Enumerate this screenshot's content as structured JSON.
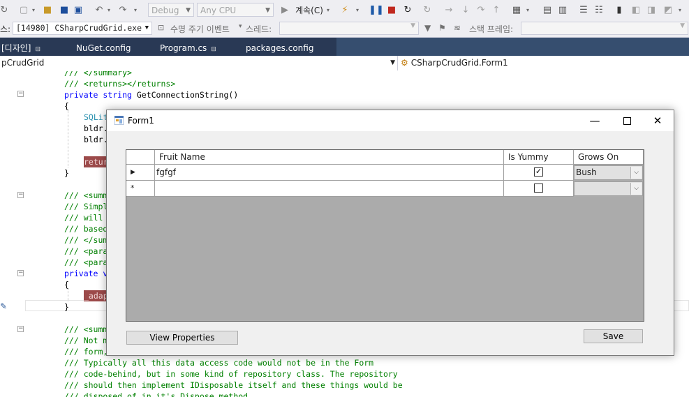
{
  "toolbar": {
    "config_combo": "Debug",
    "platform_combo": "Any CPU",
    "continue_label": "계속(C)"
  },
  "debug_bar": {
    "process_label": "스:",
    "process_value": "[14980] CSharpCrudGrid.exe",
    "lifecycle_label": "수명 주기 이벤트",
    "thread_label": "스레드:",
    "stackframe_label": "스택 프레임:"
  },
  "tabs": [
    {
      "label": "[디자인]",
      "pinned": true
    },
    {
      "label": "NuGet.config",
      "pinned": false
    },
    {
      "label": "Program.cs",
      "pinned": true
    },
    {
      "label": "packages.config",
      "pinned": false
    }
  ],
  "navbar": {
    "project": "pCrudGrid",
    "type": "CSharpCrudGrid.Form1"
  },
  "code": [
    "/// </summary>",
    "/// <returns></returns>",
    "private string GetConnectionString()",
    "{",
    "SQLit",
    "bldr.",
    "bldr.",
    "retur",
    "}",
    "/// <summ",
    "/// Simpl",
    "/// will ",
    "/// based",
    "/// </sum",
    "/// <para",
    "/// <para",
    "private v",
    "{",
    "_adap",
    "}",
    "/// <summ",
    "/// Not m",
    "/// form,",
    "/// Typically all this data access code would not be in the Form",
    "/// code-behind, but in some kind of repository class. The repository",
    "/// should then implement IDisposable itself and these things would be",
    "/// disposed of in it's Dispose method."
  ],
  "form": {
    "title": "Form1",
    "grid": {
      "columns": [
        "Fruit Name",
        "Is Yummy",
        "Grows On"
      ],
      "rows": [
        {
          "name": "fgfgf",
          "yummy": true,
          "grows_on": "Bush"
        },
        {
          "name": "",
          "yummy": false,
          "grows_on": ""
        }
      ]
    },
    "buttons": {
      "view_properties": "View Properties",
      "save": "Save"
    }
  }
}
